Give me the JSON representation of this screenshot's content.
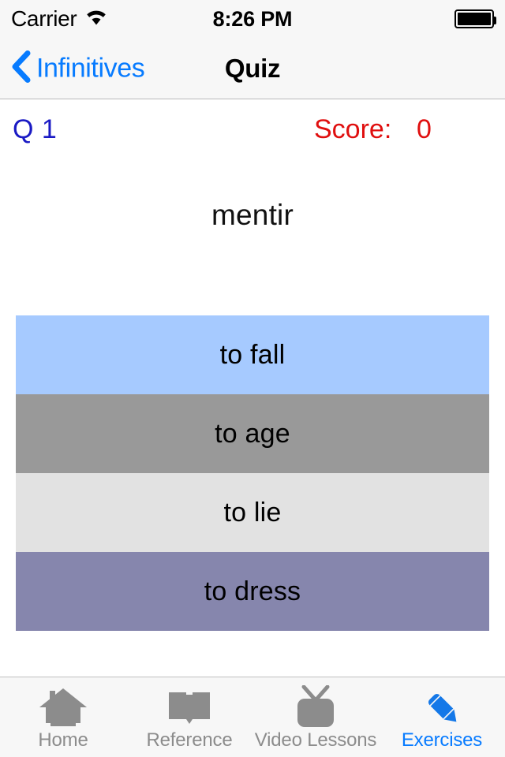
{
  "status_bar": {
    "carrier": "Carrier",
    "wifi_icon": "wifi-icon",
    "time": "8:26 PM",
    "battery_icon": "battery-full-icon"
  },
  "nav_bar": {
    "back_icon": "chevron-left-icon",
    "back_label": "Infinitives",
    "title": "Quiz"
  },
  "quiz": {
    "question_counter": "Q 1",
    "score_label": "Score:",
    "score_value": "0",
    "prompt_word": "mentir",
    "answers": [
      {
        "label": "to fall",
        "color": "#a6caff"
      },
      {
        "label": "to age",
        "color": "#999999"
      },
      {
        "label": "to lie",
        "color": "#e2e2e2"
      },
      {
        "label": "to dress",
        "color": "#8686ad"
      }
    ]
  },
  "tab_bar": {
    "items": [
      {
        "label": "Home",
        "icon": "home-icon",
        "active": false
      },
      {
        "label": "Reference",
        "icon": "book-icon",
        "active": false
      },
      {
        "label": "Video Lessons",
        "icon": "tv-icon",
        "active": false
      },
      {
        "label": "Exercises",
        "icon": "pencil-icon",
        "active": true
      }
    ]
  },
  "colors": {
    "ios_blue": "#077bff",
    "score_red": "#e00f0f",
    "counter_blue": "#1a1ac4",
    "tab_inactive_gray": "#8c8c8c",
    "bar_background": "#f7f7f7"
  }
}
